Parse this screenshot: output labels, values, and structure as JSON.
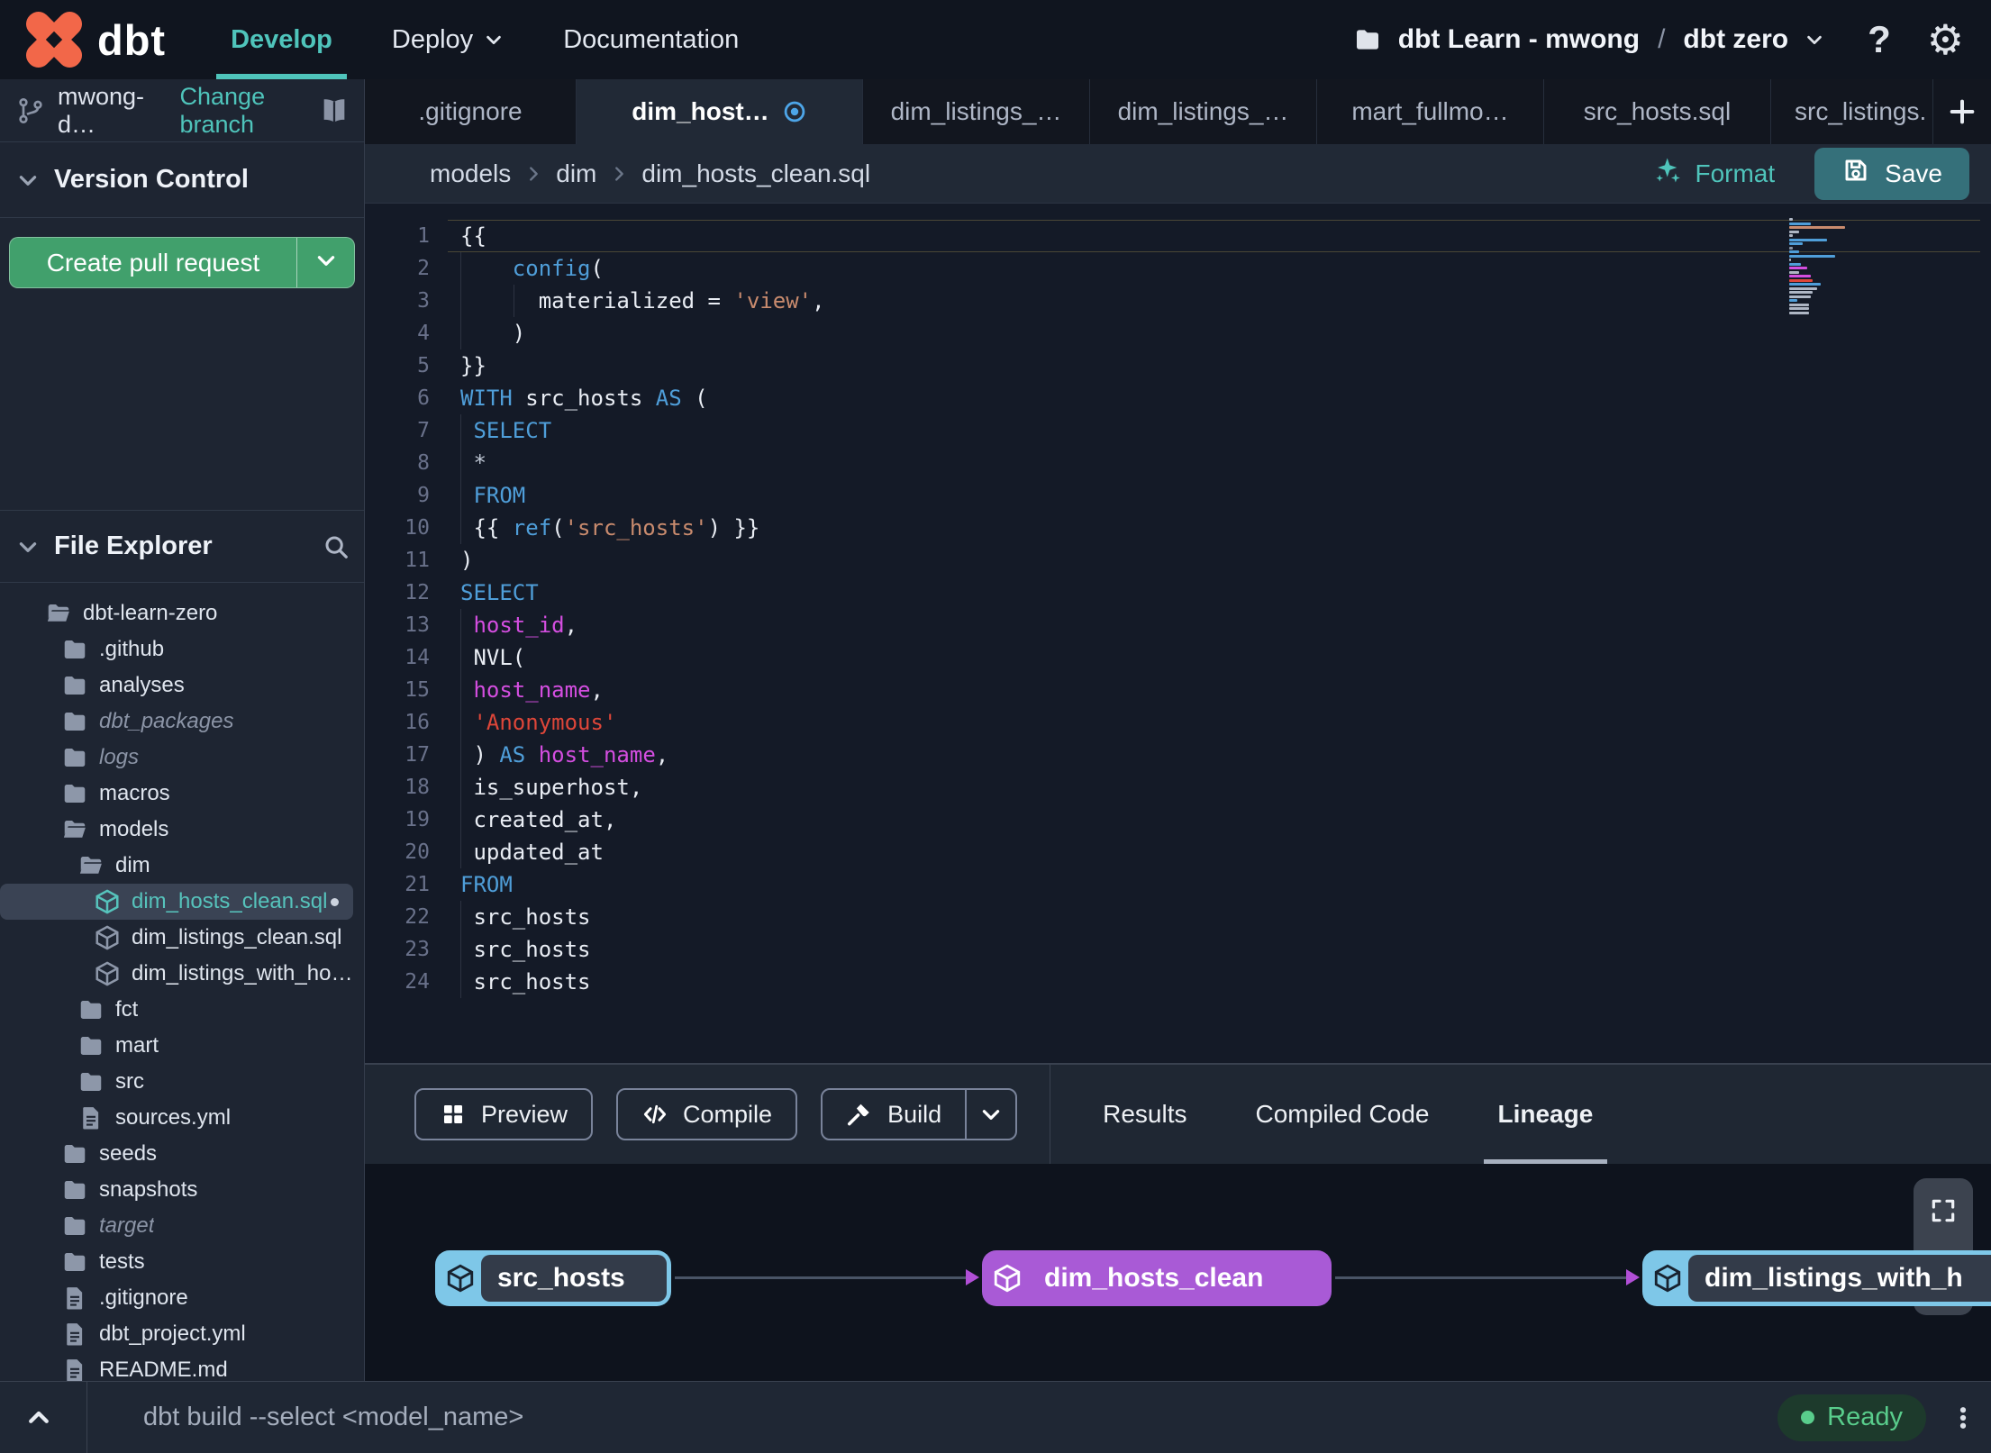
{
  "topnav": {
    "brand": "dbt",
    "items": [
      {
        "label": "Develop",
        "active": true
      },
      {
        "label": "Deploy",
        "chevron": true
      },
      {
        "label": "Documentation"
      }
    ],
    "account": {
      "project": "dbt Learn - mwong",
      "separator": "/",
      "environment": "dbt zero"
    }
  },
  "sidebar": {
    "branch": {
      "name": "mwong-d…",
      "change_link": "Change branch"
    },
    "version_control": {
      "title": "Version Control",
      "create_pr_label": "Create pull request"
    },
    "file_explorer": {
      "title": "File Explorer"
    },
    "tree": [
      {
        "label": "dbt-learn-zero",
        "type": "folder-open",
        "depth": 0
      },
      {
        "label": ".github",
        "type": "folder",
        "depth": 1
      },
      {
        "label": "analyses",
        "type": "folder",
        "depth": 1
      },
      {
        "label": "dbt_packages",
        "type": "folder",
        "depth": 1,
        "muted": true
      },
      {
        "label": "logs",
        "type": "folder",
        "depth": 1,
        "muted": true
      },
      {
        "label": "macros",
        "type": "folder",
        "depth": 1
      },
      {
        "label": "models",
        "type": "folder-open",
        "depth": 1
      },
      {
        "label": "dim",
        "type": "folder-open",
        "depth": 2
      },
      {
        "label": "dim_hosts_clean.sql",
        "type": "model",
        "depth": 3,
        "selected": true,
        "modified": true
      },
      {
        "label": "dim_listings_clean.sql",
        "type": "model",
        "depth": 3
      },
      {
        "label": "dim_listings_with_hosts…",
        "type": "model",
        "depth": 3
      },
      {
        "label": "fct",
        "type": "folder",
        "depth": 2
      },
      {
        "label": "mart",
        "type": "folder",
        "depth": 2
      },
      {
        "label": "src",
        "type": "folder",
        "depth": 2
      },
      {
        "label": "sources.yml",
        "type": "file",
        "depth": 2
      },
      {
        "label": "seeds",
        "type": "folder",
        "depth": 1
      },
      {
        "label": "snapshots",
        "type": "folder",
        "depth": 1
      },
      {
        "label": "target",
        "type": "folder",
        "depth": 1,
        "muted": true
      },
      {
        "label": "tests",
        "type": "folder",
        "depth": 1
      },
      {
        "label": ".gitignore",
        "type": "file",
        "depth": 1
      },
      {
        "label": "dbt_project.yml",
        "type": "file",
        "depth": 1
      },
      {
        "label": "README.md",
        "type": "file",
        "depth": 1
      }
    ]
  },
  "tabs": [
    {
      "label": ".gitignore"
    },
    {
      "label": "dim_host…",
      "active": true,
      "modified": true
    },
    {
      "label": "dim_listings_…"
    },
    {
      "label": "dim_listings_…"
    },
    {
      "label": "mart_fullmo…"
    },
    {
      "label": "src_hosts.sql"
    },
    {
      "label": "src_listings."
    }
  ],
  "editor": {
    "breadcrumb": [
      "models",
      "dim",
      "dim_hosts_clean.sql"
    ],
    "format_label": "Format",
    "save_label": "Save",
    "lines": [
      {
        "n": 1,
        "cur": true,
        "g": [],
        "t": [
          [
            "{{",
            "pl"
          ]
        ]
      },
      {
        "n": 2,
        "g": [
          0
        ],
        "t": [
          [
            "    ",
            "pl"
          ],
          [
            "config",
            "kw"
          ],
          [
            "(",
            "pl"
          ]
        ]
      },
      {
        "n": 3,
        "g": [
          0,
          4
        ],
        "t": [
          [
            "      materialized = ",
            "pl"
          ],
          [
            "'view'",
            "str"
          ],
          [
            ",",
            "pl"
          ]
        ]
      },
      {
        "n": 4,
        "g": [
          0
        ],
        "t": [
          [
            "    )",
            "pl"
          ]
        ]
      },
      {
        "n": 5,
        "g": [],
        "t": [
          [
            "}}",
            "pl"
          ]
        ]
      },
      {
        "n": 6,
        "g": [],
        "t": [
          [
            "WITH",
            "kw"
          ],
          [
            " src_hosts ",
            "pl"
          ],
          [
            "AS",
            "kw"
          ],
          [
            " (",
            "pl"
          ]
        ]
      },
      {
        "n": 7,
        "g": [
          0
        ],
        "t": [
          [
            " ",
            "pl"
          ],
          [
            "SELECT",
            "kw"
          ]
        ]
      },
      {
        "n": 8,
        "g": [
          0
        ],
        "t": [
          [
            " ",
            "pl"
          ],
          [
            "*",
            "dim"
          ]
        ]
      },
      {
        "n": 9,
        "g": [
          0
        ],
        "t": [
          [
            " ",
            "pl"
          ],
          [
            "FROM",
            "kw"
          ]
        ]
      },
      {
        "n": 10,
        "g": [
          0
        ],
        "t": [
          [
            " {{ ",
            "pl"
          ],
          [
            "ref",
            "kw"
          ],
          [
            "(",
            "pl"
          ],
          [
            "'src_hosts'",
            "str"
          ],
          [
            ") }}",
            "pl"
          ]
        ]
      },
      {
        "n": 11,
        "g": [],
        "t": [
          [
            ")",
            "pl"
          ]
        ]
      },
      {
        "n": 12,
        "g": [],
        "t": [
          [
            "SELECT",
            "kw"
          ]
        ]
      },
      {
        "n": 13,
        "g": [
          0
        ],
        "t": [
          [
            " ",
            "pl"
          ],
          [
            "host_id",
            "fld"
          ],
          [
            ",",
            "pl"
          ]
        ]
      },
      {
        "n": 14,
        "g": [
          0
        ],
        "t": [
          [
            " NVL(",
            "pl"
          ]
        ]
      },
      {
        "n": 15,
        "g": [
          0
        ],
        "t": [
          [
            " ",
            "pl"
          ],
          [
            "host_name",
            "fld"
          ],
          [
            ",",
            "pl"
          ]
        ]
      },
      {
        "n": 16,
        "g": [
          0
        ],
        "t": [
          [
            " ",
            "pl"
          ],
          [
            "'Anonymous'",
            "str2"
          ]
        ]
      },
      {
        "n": 17,
        "g": [
          0
        ],
        "t": [
          [
            " ) ",
            "pl"
          ],
          [
            "AS",
            "kw"
          ],
          [
            " ",
            "pl"
          ],
          [
            "host_name",
            "fld"
          ],
          [
            ",",
            "pl"
          ]
        ]
      },
      {
        "n": 18,
        "g": [
          0
        ],
        "t": [
          [
            " is_superhost,",
            "pl"
          ]
        ]
      },
      {
        "n": 19,
        "g": [
          0
        ],
        "t": [
          [
            " created_at,",
            "pl"
          ]
        ]
      },
      {
        "n": 20,
        "g": [
          0
        ],
        "t": [
          [
            " updated_at",
            "pl"
          ]
        ]
      },
      {
        "n": 21,
        "g": [],
        "t": [
          [
            "FROM",
            "kw"
          ]
        ]
      },
      {
        "n": 22,
        "g": [
          0
        ],
        "t": [
          [
            " src_hosts",
            "pl"
          ]
        ]
      },
      {
        "n": 23,
        "g": [
          0
        ],
        "t": [
          [
            " src_hosts",
            "pl"
          ]
        ]
      },
      {
        "n": 24,
        "g": [
          0
        ],
        "t": [
          [
            " src_hosts",
            "pl"
          ]
        ]
      }
    ]
  },
  "panel": {
    "buttons": [
      {
        "label": "Preview",
        "icon": "grid"
      },
      {
        "label": "Compile",
        "icon": "code"
      },
      {
        "label": "Build",
        "icon": "hammer",
        "split": true
      }
    ],
    "tabs": [
      {
        "label": "Results"
      },
      {
        "label": "Compiled Code"
      },
      {
        "label": "Lineage",
        "active": true
      }
    ]
  },
  "lineage": {
    "nodes": [
      {
        "label": "src_hosts",
        "color": "blue"
      },
      {
        "label": "dim_hosts_clean",
        "color": "purple"
      },
      {
        "label": "dim_listings_with_h",
        "color": "blue"
      }
    ]
  },
  "statusbar": {
    "command": "dbt build --select <model_name>",
    "status": "Ready"
  },
  "colors": {
    "accent_teal": "#4fc4bb",
    "green_button": "#41a06c",
    "save_button": "#35707a",
    "node_blue": "#7ec7e8",
    "node_purple": "#a95ad6",
    "ready_green": "#59cd8c",
    "modified_blue": "#4da5e8",
    "syntax_keyword": "#4f9ed9",
    "syntax_string": "#c98b6e",
    "syntax_string_red": "#de4639",
    "syntax_field": "#d44ee0"
  }
}
